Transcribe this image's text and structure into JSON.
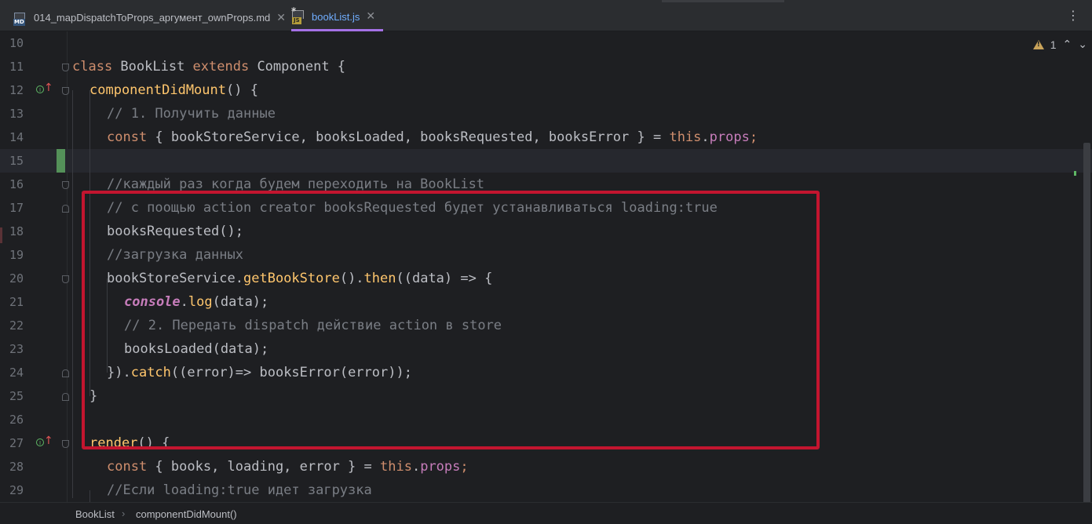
{
  "tabs": [
    {
      "label": "014_mapDispatchToProps_аргумент_ownProps.md",
      "icon": "markdown-file-icon",
      "icon_text": "MD",
      "active": false
    },
    {
      "label": "bookList.js",
      "icon": "javascript-file-icon",
      "icon_text": "JS",
      "active": true
    }
  ],
  "window_menu_icon": "⋮",
  "inspection": {
    "warning_count": "1"
  },
  "breadcrumb": {
    "class_name": "BookList",
    "separator": "›",
    "method_name": "componentDidMount()"
  },
  "editor": {
    "current_line": 15,
    "lines": [
      {
        "num": "10"
      },
      {
        "num": "11",
        "t": {
          "a": "class",
          "b": " BookList ",
          "c": "extends",
          "d": " Component {"
        }
      },
      {
        "num": "12",
        "t": {
          "a": "componentDidMount",
          "b": "() {"
        }
      },
      {
        "num": "13",
        "t": {
          "a": "// 1. Получить данные"
        }
      },
      {
        "num": "14",
        "t": {
          "a": "const",
          "b": " { bookStoreService, booksLoaded, booksRequested, booksError } = ",
          "c": "this",
          "d": ".",
          "e": "props",
          "f": ";"
        }
      },
      {
        "num": "15"
      },
      {
        "num": "16",
        "t": {
          "a": "//каждый раз когда будем переходить на BookList"
        }
      },
      {
        "num": "17",
        "t": {
          "a": "// с поощью action creator booksRequested будет устанавливаться loading:true"
        }
      },
      {
        "num": "18",
        "t": {
          "a": "booksRequested();"
        }
      },
      {
        "num": "19",
        "t": {
          "a": "//загрузка данных"
        }
      },
      {
        "num": "20",
        "t": {
          "a": "bookStoreService.",
          "b": "getBookStore",
          "c": "().",
          "d": "then",
          "e": "((data) => {"
        }
      },
      {
        "num": "21",
        "t": {
          "a": "console",
          "b": ".",
          "c": "log",
          "d": "(data);"
        }
      },
      {
        "num": "22",
        "t": {
          "a": "// 2. Передать dispatch действие action в store"
        }
      },
      {
        "num": "23",
        "t": {
          "a": "booksLoaded(data);"
        }
      },
      {
        "num": "24",
        "t": {
          "a": "}).",
          "b": "catch",
          "c": "((error)=> booksError(error));"
        }
      },
      {
        "num": "25",
        "t": {
          "a": "}"
        }
      },
      {
        "num": "26"
      },
      {
        "num": "27",
        "t": {
          "a": "render",
          "b": "() {"
        }
      },
      {
        "num": "28",
        "t": {
          "a": "const",
          "b": " { books, loading, error } = ",
          "c": "this",
          "d": ".",
          "e": "props",
          "f": ";"
        }
      },
      {
        "num": "29",
        "t": {
          "a": "//Если loading:true идет загрузка"
        }
      }
    ]
  }
}
